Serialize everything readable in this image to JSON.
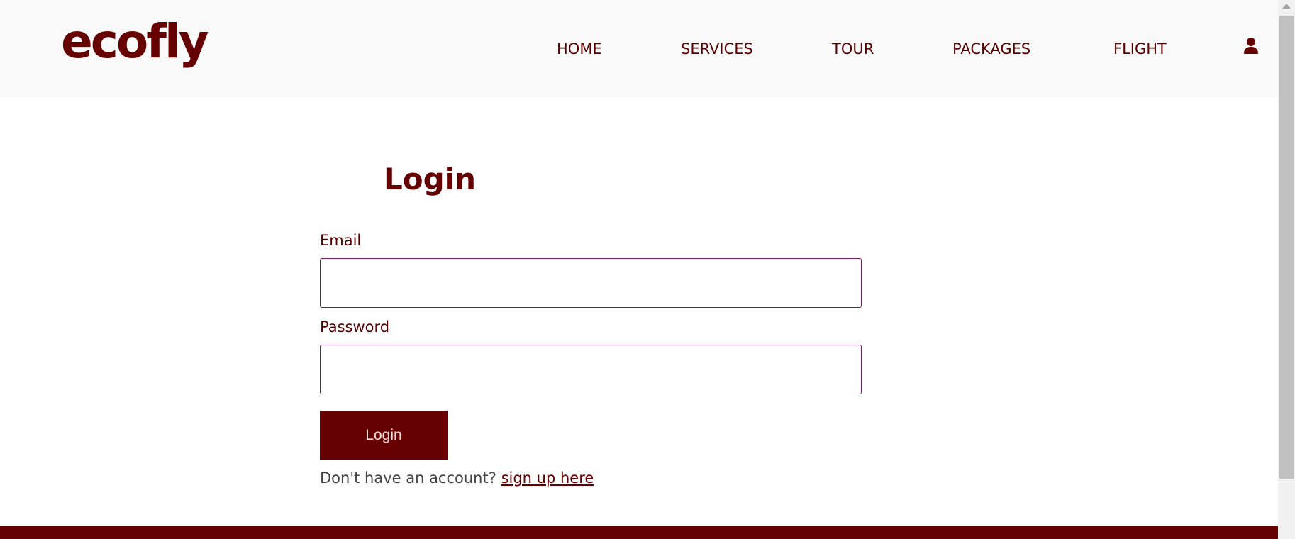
{
  "brand": {
    "logo_text": "ecofly",
    "primary_color": "#660000"
  },
  "nav": {
    "items": [
      {
        "label": "HOME"
      },
      {
        "label": "SERVICES"
      },
      {
        "label": "TOUR"
      },
      {
        "label": "PACKAGES"
      },
      {
        "label": "FLIGHT"
      }
    ],
    "user_icon": "user-icon"
  },
  "login": {
    "title": "Login",
    "email_label": "Email",
    "email_value": "",
    "password_label": "Password",
    "password_value": "",
    "submit_label": "Login",
    "signup_prompt": "Don't have an account?",
    "signup_link": "sign up here"
  }
}
